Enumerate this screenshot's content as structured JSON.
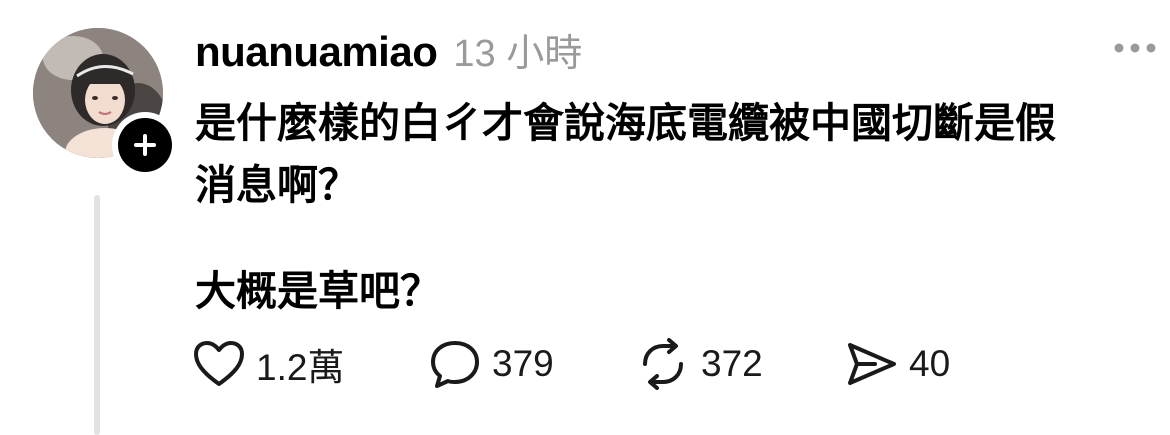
{
  "post": {
    "author": "nuanuamiao",
    "timestamp": "13 小時",
    "content_lines": [
      "是什麼樣的白ㄔ才會說海底電纜被中國切斷是假",
      "消息啊？",
      "大概是草吧？"
    ],
    "actions": {
      "like_count": "1.2萬",
      "reply_count": "379",
      "repost_count": "372",
      "share_count": "40"
    }
  },
  "icons": {
    "avatar": "avatar-photo",
    "follow": "plus-icon",
    "more": "more-horizontal-icon",
    "like": "heart-icon",
    "reply": "speech-bubble-icon",
    "repost": "repost-arrows-icon",
    "share": "send-arrow-icon"
  },
  "colors": {
    "text": "#000000",
    "muted": "#9a9a9a",
    "thread_line": "#e3e3e3",
    "badge": "#000000"
  }
}
